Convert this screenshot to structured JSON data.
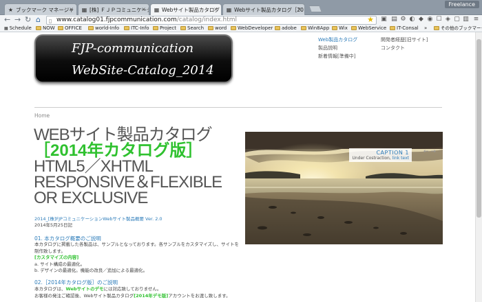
{
  "browser": {
    "profile": "Freelance",
    "tabs": [
      {
        "icon": "star-icon",
        "label": "ブックマーク マネージャ"
      },
      {
        "icon": "page-icon",
        "label": "[株] ＦＪＰコミュニケーション"
      },
      {
        "icon": "page-icon",
        "label": "Webサイト製品カタログ［20"
      },
      {
        "icon": "page-icon",
        "label": "Webサイト製品カタログ［20"
      }
    ],
    "url": {
      "host": "www.catalog01.fjpcommunication.com",
      "path": "/catalog/index.html"
    }
  },
  "bookmarks": [
    {
      "label": "Schedule",
      "type": "page"
    },
    {
      "label": "NOW",
      "type": "folder"
    },
    {
      "label": "OFFICE",
      "type": "folder"
    },
    {
      "label": "world-Info",
      "type": "folder"
    },
    {
      "label": "ITC-Info",
      "type": "folder"
    },
    {
      "label": "Project",
      "type": "folder"
    },
    {
      "label": "Search",
      "type": "folder"
    },
    {
      "label": "word",
      "type": "folder"
    },
    {
      "label": "WebDeveloper",
      "type": "folder"
    },
    {
      "label": "adobe",
      "type": "folder"
    },
    {
      "label": "Win8App",
      "type": "folder"
    },
    {
      "label": "Wix",
      "type": "folder"
    },
    {
      "label": "WebService",
      "type": "folder"
    },
    {
      "label": "IT-Consal",
      "type": "folder"
    },
    {
      "label": "»",
      "type": "more"
    },
    {
      "label": "その他のブックマーク",
      "type": "folder"
    }
  ],
  "site": {
    "logo_line1": "FJP-communication",
    "logo_line2": "WebSite-Catalog_2014",
    "nav_col1": [
      "Web製品カタログ",
      "製品説明",
      "新着情報[準備中]"
    ],
    "nav_col2": [
      "開発者経歴[旧サイト]",
      "コンタクト"
    ],
    "breadcrumb": "Home",
    "heading": {
      "line1": "WEBサイト製品カタログ",
      "line2": "［2014年カタログ版］",
      "line3": "HTML5／XHTML",
      "line4": "RESPONSIVE＆FLEXIBLE",
      "line5": "OR EXCLUSIVE"
    },
    "meta_title": "2014_[株]FJPコミュニケーションWebサイト製品概要 ",
    "meta_version": "Ver. 2.0",
    "meta_date": "2014年5月25日記",
    "section1_title": "01. 本カタログ概要のご説明",
    "section1_lines": [
      "本カタログに掲載した各製品は、サンプルとなっております。各サンプルをカスタマイズし、サイトを",
      "制作致します。"
    ],
    "section1_green": "[カスタマイズの内容]",
    "section1_items": [
      "a. サイト構成の最適化。",
      "b. デザインの最適化。機能の改良／追加による最適化。"
    ],
    "section2_title": "02.［2014年カタログ版］のご説明",
    "section2_line1a": "本カタログは、",
    "section2_line1b": "Webサイトのデモ",
    "section2_line1c": "には対応致しておりません。",
    "section2_line2a": "お客様の発注ご確認後、Webサイト製品カタログ",
    "section2_line2b": "[2014年デモ版]",
    "section2_line2c": "アカウントをお渡し致します。",
    "slider": {
      "caption_title": "CAPTION 1",
      "caption_text": "Under Costraction, ",
      "caption_link": "link text",
      "prev": "←",
      "next": "→"
    }
  },
  "colors": {
    "accent_blue": "#2b7bb9",
    "accent_green": "#2fc12f",
    "text": "#555555"
  }
}
